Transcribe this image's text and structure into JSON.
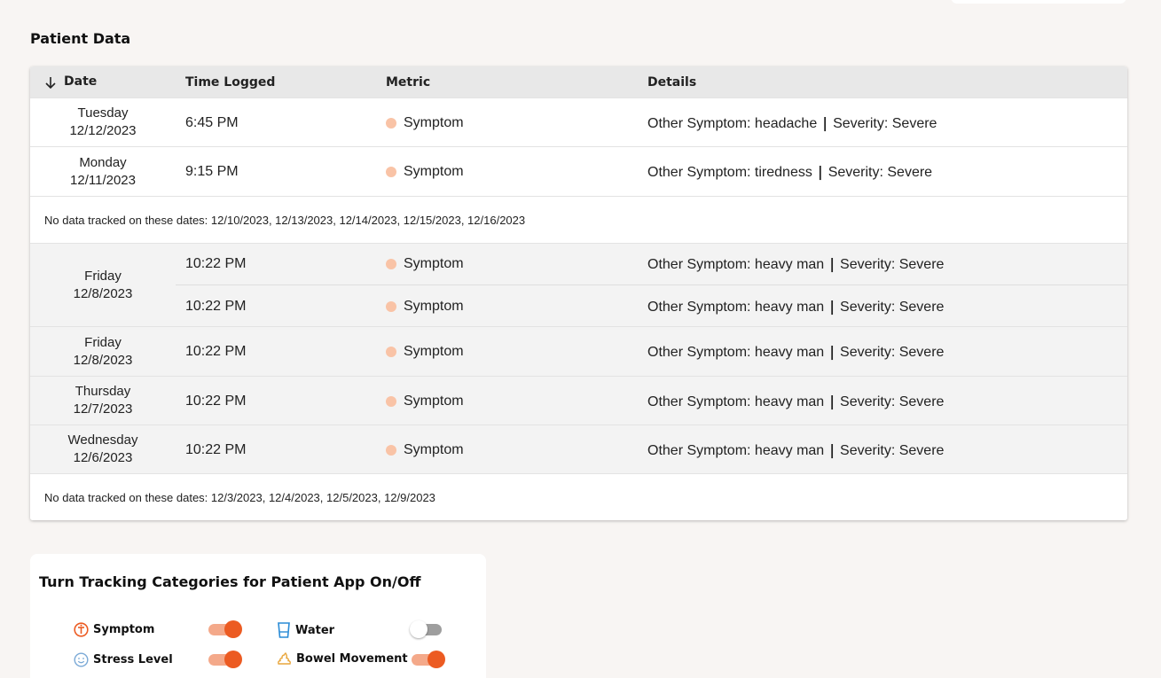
{
  "section_title": "Patient Data",
  "table": {
    "headers": {
      "date": "Date",
      "time": "Time Logged",
      "metric": "Metric",
      "details": "Details"
    },
    "sort_icon": "arrow-down-icon",
    "metric_dot_color": "#f9c3a6",
    "rows": [
      {
        "day": "Tuesday",
        "date": "12/12/2023",
        "entries": [
          {
            "time": "6:45 PM",
            "metric": "Symptom",
            "symptom": "Other Symptom: headache",
            "severity": "Severity: Severe"
          }
        ]
      },
      {
        "day": "Monday",
        "date": "12/11/2023",
        "entries": [
          {
            "time": "9:15 PM",
            "metric": "Symptom",
            "symptom": "Other Symptom: tiredness",
            "severity": "Severity: Severe"
          }
        ]
      }
    ],
    "no_data_1": "No data tracked on these dates: 12/10/2023, 12/13/2023, 12/14/2023, 12/15/2023, 12/16/2023",
    "rows2": [
      {
        "day": "Friday",
        "date": "12/8/2023",
        "entries": [
          {
            "time": "10:22 PM",
            "metric": "Symptom",
            "symptom": "Other Symptom: heavy man",
            "severity": "Severity: Severe"
          },
          {
            "time": "10:22 PM",
            "metric": "Symptom",
            "symptom": "Other Symptom: heavy man",
            "severity": "Severity: Severe"
          }
        ]
      },
      {
        "day": "Friday",
        "date": "12/8/2023",
        "entries": [
          {
            "time": "10:22 PM",
            "metric": "Symptom",
            "symptom": "Other Symptom: heavy man",
            "severity": "Severity: Severe"
          }
        ]
      },
      {
        "day": "Thursday",
        "date": "12/7/2023",
        "entries": [
          {
            "time": "10:22 PM",
            "metric": "Symptom",
            "symptom": "Other Symptom: heavy man",
            "severity": "Severity: Severe"
          }
        ]
      },
      {
        "day": "Wednesday",
        "date": "12/6/2023",
        "entries": [
          {
            "time": "10:22 PM",
            "metric": "Symptom",
            "symptom": "Other Symptom: heavy man",
            "severity": "Severity: Severe"
          }
        ]
      }
    ],
    "no_data_2": "No data tracked on these dates: 12/3/2023, 12/4/2023, 12/5/2023, 12/9/2023"
  },
  "tracking": {
    "title": "Turn Tracking Categories for Patient App On/Off",
    "accent_color": "#ec5b22",
    "categories": [
      {
        "label": "Symptom",
        "icon": "symptom-icon",
        "on": true
      },
      {
        "label": "Water",
        "icon": "water-glass-icon",
        "on": false
      },
      {
        "label": "Stress Level",
        "icon": "smiley-face-icon",
        "on": true
      },
      {
        "label": "Bowel Movement",
        "icon": "bowel-movement-icon",
        "on": true
      }
    ]
  }
}
